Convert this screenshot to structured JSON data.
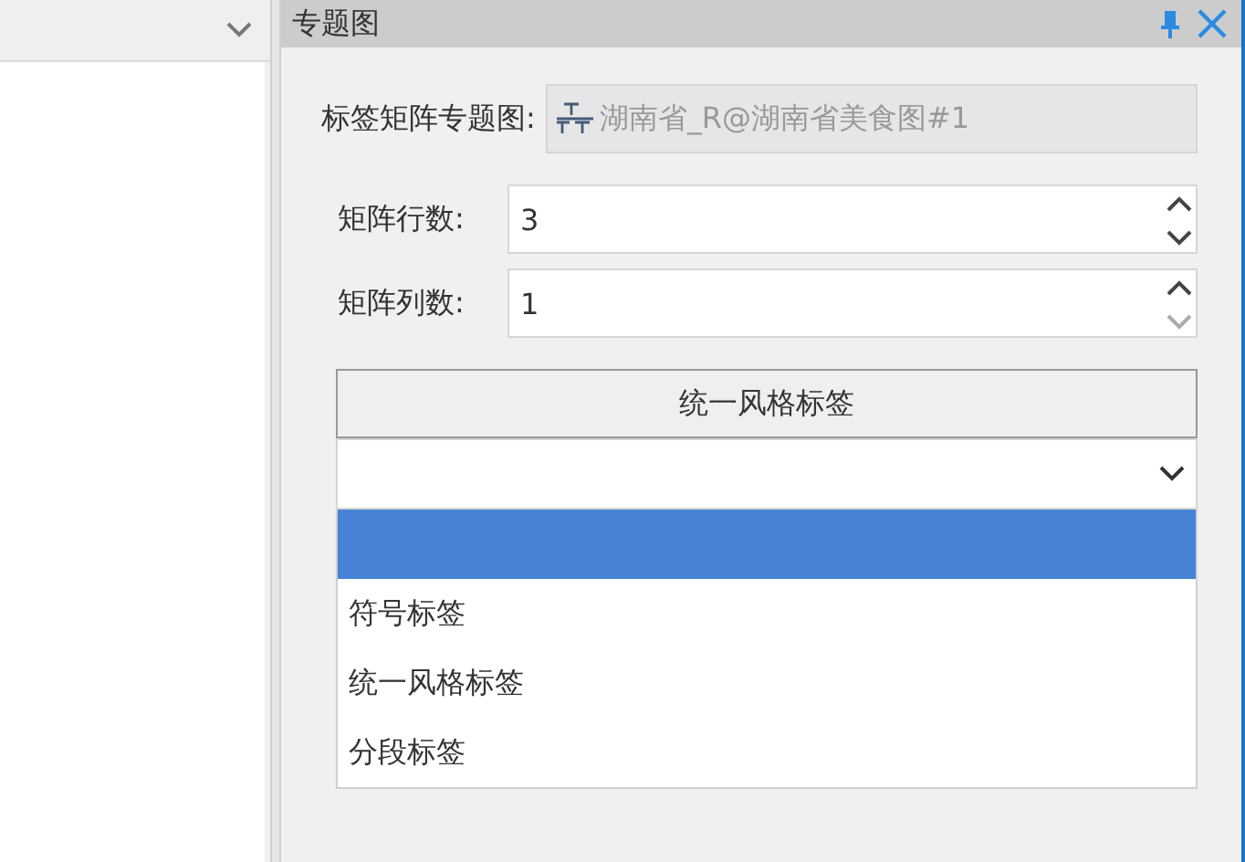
{
  "panel": {
    "title": "专题图"
  },
  "layer": {
    "label": "标签矩阵专题图:",
    "value": "湖南省_R@湖南省美食图#1",
    "disabled": true
  },
  "spinners": [
    {
      "label": "矩阵行数:",
      "value": "3",
      "up_disabled": false,
      "down_disabled": false
    },
    {
      "label": "矩阵列数:",
      "value": "1",
      "up_disabled": false,
      "down_disabled": true
    }
  ],
  "style_button": {
    "label": "统一风格标签"
  },
  "combo": {
    "expanded": true,
    "options": [
      {
        "selected": true
      },
      {
        "label": "符号标签",
        "selected": false
      },
      {
        "label": "统一风格标签",
        "selected": false
      },
      {
        "label": "分段标签",
        "selected": false
      }
    ]
  }
}
